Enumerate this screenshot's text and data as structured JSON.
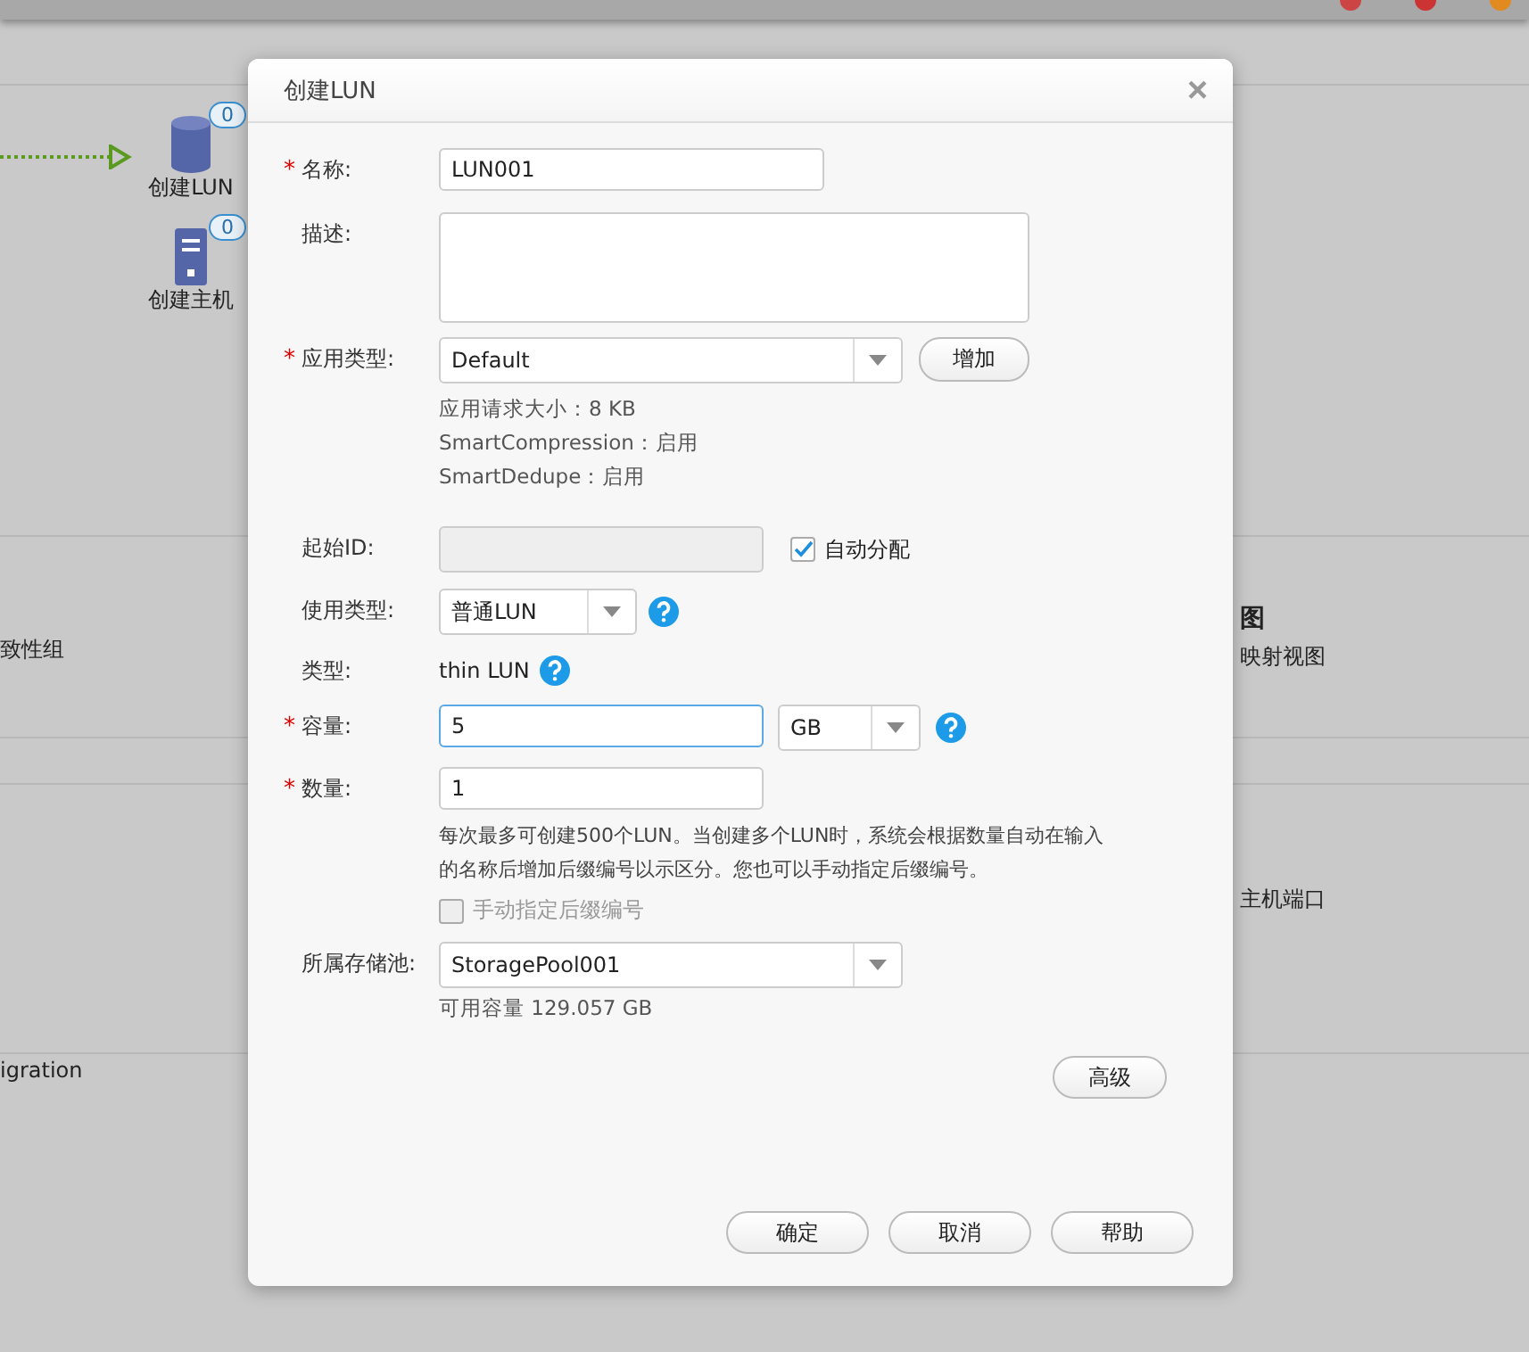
{
  "background": {
    "flow_nodes": [
      {
        "label": "创建LUN",
        "count": "0",
        "kind": "disk"
      },
      {
        "label": "创建主机",
        "count": "0",
        "kind": "server"
      }
    ],
    "left_texts": [
      "致性组",
      "igration"
    ],
    "right_texts": [
      "图",
      "映射视图",
      "主机端口"
    ]
  },
  "dialog": {
    "title": "创建LUN",
    "close": "×",
    "required_mark": "*",
    "name": {
      "label": "名称:",
      "required": true,
      "value": "LUN001"
    },
    "description": {
      "label": "描述:",
      "required": false
    },
    "app_type": {
      "label": "应用类型:",
      "required": true,
      "value": "Default",
      "button": "增加",
      "info": [
        "应用请求大小：8 KB",
        "SmartCompression：启用",
        "SmartDedupe：启用"
      ]
    },
    "start_id": {
      "label": "起始ID:",
      "disabled": true,
      "auto": {
        "label": "自动分配",
        "checked": true
      }
    },
    "usage_type": {
      "label": "使用类型:",
      "value": "普通LUN"
    },
    "type": {
      "label": "类型:",
      "value": "thin LUN"
    },
    "capacity": {
      "label": "容量:",
      "required": true,
      "value": "5",
      "unit": "GB"
    },
    "quantity": {
      "label": "数量:",
      "required": true,
      "value": "1",
      "hint": "每次最多可创建500个LUN。当创建多个LUN时，系统会根据数量自动在输入的名称后增加后缀编号以示区分。您也可以手动指定后缀编号。",
      "manual": {
        "label": "手动指定后缀编号",
        "checked": false,
        "disabled": true
      }
    },
    "pool": {
      "label": "所属存储池:",
      "value": "StoragePool001",
      "available": "可用容量 129.057 GB"
    },
    "advanced": "高级",
    "buttons": [
      "确定",
      "取消",
      "帮助"
    ]
  }
}
